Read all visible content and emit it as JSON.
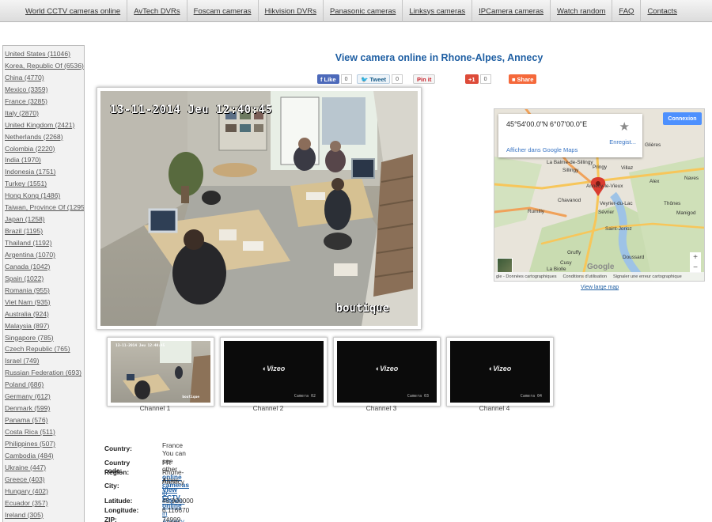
{
  "nav": {
    "items": [
      "World CCTV cameras online",
      "AvTech DVRs",
      "Foscam cameras",
      "Hikvision DVRs",
      "Panasonic cameras",
      "Linksys cameras",
      "IPCamera cameras",
      "Watch random",
      "FAQ",
      "Contacts"
    ]
  },
  "sidebar": {
    "countries": [
      "United States (11046)",
      "Korea, Republic Of (6536)",
      "China (4770)",
      "Mexico (3359)",
      "France (3285)",
      "Italy (2870)",
      "United Kingdom (2421)",
      "Netherlands (2268)",
      "Colombia (2220)",
      "India (1970)",
      "Indonesia (1751)",
      "Turkey (1551)",
      "Hong Kong (1486)",
      "Taiwan, Province Of (1295)",
      "Japan (1258)",
      "Brazil (1195)",
      "Thailand (1192)",
      "Argentina (1070)",
      "Canada (1042)",
      "Spain (1022)",
      "Romania (955)",
      "Viet Nam (935)",
      "Australia (924)",
      "Malaysia (897)",
      "Singapore (785)",
      "Czech Republic (765)",
      "Israel (749)",
      "Russian Federation (693)",
      "Poland (686)",
      "Germany (612)",
      "Denmark (599)",
      "Panama (576)",
      "Costa Rica (511)",
      "Philippines (507)",
      "Cambodia (484)",
      "Ukraine (447)",
      "Greece (403)",
      "Hungary (402)",
      "Ecuador (357)",
      "Ireland (305)"
    ]
  },
  "title": "View camera online in Rhone-Alpes, Annecy",
  "share": {
    "facebook": {
      "label": "Like",
      "count": "0"
    },
    "twitter": {
      "label": "Tweet",
      "count": "0"
    },
    "pinterest": {
      "label": "Pin it"
    },
    "gplus": {
      "label": "+1",
      "count": "0"
    },
    "share": {
      "label": "Share"
    }
  },
  "camera": {
    "timestamp": "13-11-2014 Jeu 12:40:45",
    "label": "boutique"
  },
  "thumbnails": [
    {
      "caption": "Channel 1",
      "type": "live"
    },
    {
      "caption": "Channel 2",
      "type": "vizeo",
      "brand": "Vizeo",
      "camera": "Camera 02"
    },
    {
      "caption": "Channel 3",
      "type": "vizeo",
      "brand": "Vizeo",
      "camera": "Camera 03"
    },
    {
      "caption": "Channel 4",
      "type": "vizeo",
      "brand": "Vizeo",
      "camera": "Camera 04"
    }
  ],
  "map": {
    "coords": "45°54'00.0\"N 6°07'00.0\"E",
    "save": "Enregist...",
    "open_in_maps": "Afficher dans Google Maps",
    "connexion": "Connexion",
    "logo": "Google",
    "footer": [
      "gle - Données cartographiques",
      "Conditions d'utilisation",
      "Signaler une erreur cartographique"
    ],
    "towns": [
      "Glières",
      "Sillingy",
      "Pringy",
      "Villaz",
      "La Balme-de-Sillingy",
      "Annecy-le-Vieux",
      "Thônes",
      "Chavanod",
      "Veyrier-du-Lac",
      "Manigod",
      "Rumilly",
      "Sévrier",
      "Saint-Jorioz",
      "Gruffy",
      "Cusy",
      "Doussard",
      "La Biolle",
      "Alex",
      "Naves"
    ],
    "large_map": "View large map"
  },
  "info": {
    "country_label": "Country:",
    "country": "France",
    "country_more_prefix": "You can see other ",
    "country_more_link": "online cameras",
    "country_more_suffix": " in France.",
    "code_label": "Country code:",
    "code": "FR",
    "region_label": "Region:",
    "region": "Rhone-Alpes",
    "city_label": "City:",
    "city": "Annecy",
    "city_link": "View CCTV online",
    "city_link_suffix": " in Annecy.",
    "lat_label": "Latitude:",
    "lat": "45.900000",
    "lon_label": "Longitude:",
    "lon": "6.116670",
    "zip_label": "ZIP:",
    "zip": "74999"
  }
}
